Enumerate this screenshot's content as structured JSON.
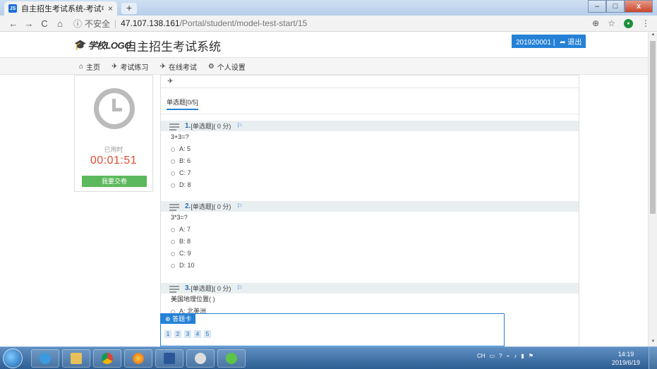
{
  "browser": {
    "tab_title": "自主招生考试系统-考试中...",
    "tab_close": "×",
    "new_tab": "+",
    "window_min": "–",
    "window_max": "□",
    "window_close": "x",
    "back": "←",
    "forward": "→",
    "reload": "C",
    "home": "⌂",
    "security": "不安全",
    "url_host": "47.107.138.161",
    "url_path": "/Portal/student/model-test-start/15",
    "zoom_icon": "⊕",
    "star_icon": "☆",
    "menu_icon": "⋮"
  },
  "header": {
    "logo_text": "学校LOGO",
    "site_title": "自主招生考试系统",
    "user_id": "201920001",
    "logout": "退出"
  },
  "menu": [
    {
      "icon": "home-icon",
      "label": "主页"
    },
    {
      "icon": "paper-plane-icon",
      "label": "考试练习"
    },
    {
      "icon": "paper-plane-icon",
      "label": "在线考试"
    },
    {
      "icon": "gears-icon",
      "label": "个人设置"
    }
  ],
  "timer": {
    "used_label": "已用时",
    "elapsed": "00:01:51",
    "submit": "我要交卷"
  },
  "panel": {
    "head_icon": "paper-plane-icon",
    "type_tab": "单选题[0/5]"
  },
  "questions": [
    {
      "num": "1.",
      "meta": "[单选题]( 0 分)",
      "text": "3+3=?",
      "options": [
        "A: 5",
        "B: 6",
        "C: 7",
        "D: 8"
      ]
    },
    {
      "num": "2.",
      "meta": "[单选题]( 0 分)",
      "text": "3*3=?",
      "options": [
        "A: 7",
        "B: 8",
        "C: 9",
        "D: 10"
      ]
    },
    {
      "num": "3.",
      "meta": "[单选题]( 0 分)",
      "text": "美国地理位置( )",
      "options": [
        "A: 北美洲"
      ]
    }
  ],
  "answer_card": {
    "title": "答题卡",
    "numbers": [
      "1",
      "2",
      "3",
      "4",
      "5"
    ]
  },
  "taskbar": {
    "tray_lang": "CH",
    "time": "14:19",
    "date": "2019/6/19"
  }
}
